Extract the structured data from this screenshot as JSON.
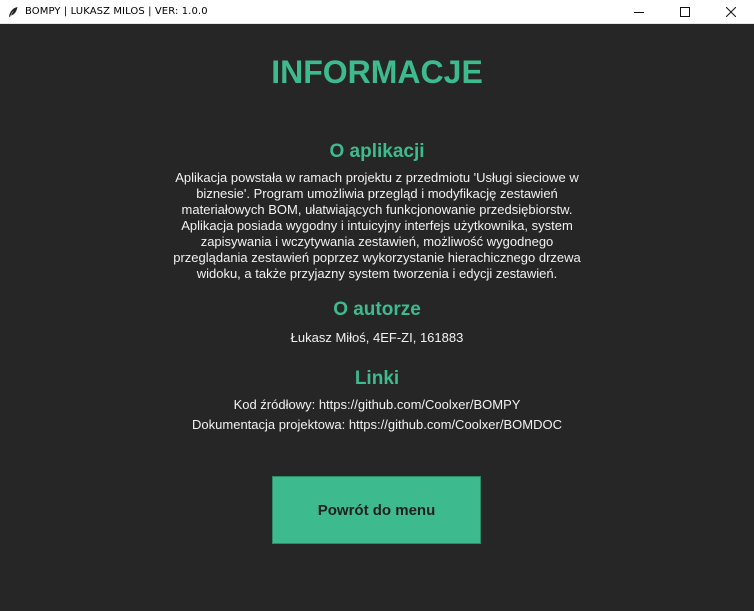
{
  "window": {
    "title": "BOMPY | LUKASZ MILOS | VER: 1.0.0",
    "controls": [
      "minimize",
      "maximize",
      "close"
    ]
  },
  "page": {
    "heading": "INFORMACJE",
    "about_app": {
      "title": "O aplikacji",
      "description": "Aplikacja powstała w ramach projektu z przedmiotu 'Usługi sieciowe w biznesie'. Program umożliwia przegląd i modyfikację zestawień materiałowych BOM, ułatwiających funkcjonowanie przedsiębiorstw. Aplikacja posiada wygodny i intuicyjny interfejs użytkownika, system zapisywania i wczytywania zestawień, możliwość wygodnego przeglądania zestawień poprzez wykorzystanie hierachicznego drzewa widoku, a także przyjazny system tworzenia i edycji zestawień."
    },
    "about_author": {
      "title": "O autorze",
      "text": "Łukasz Miłoś, 4EF-ZI, 161883"
    },
    "links": {
      "title": "Linki",
      "source_code": "Kod źródłowy: https://github.com/Coolxer/BOMPY",
      "documentation": "Dokumentacja projektowa: https://github.com/Coolxer/BOMDOC"
    },
    "back_button_label": "Powrót do menu"
  },
  "colors": {
    "background": "#262626",
    "accent": "#3dbb8e",
    "text": "#f2f2f2"
  },
  "icons": {
    "app": "feather-icon",
    "minimize": "minimize-icon",
    "maximize": "maximize-icon",
    "close": "close-icon"
  }
}
